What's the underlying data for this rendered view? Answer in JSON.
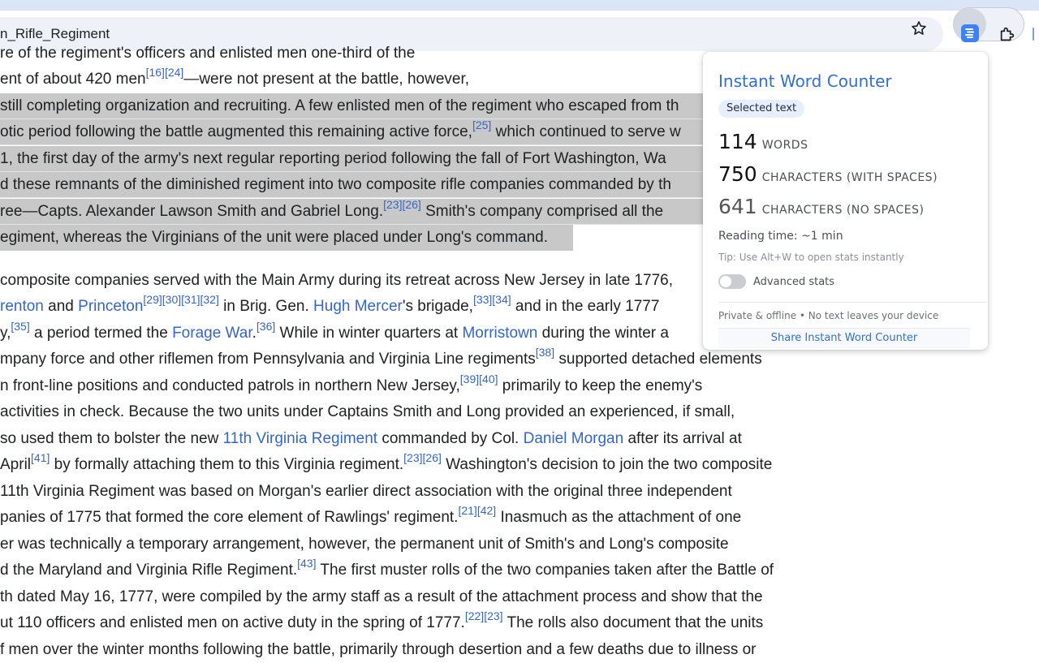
{
  "browser": {
    "address_text": "n_Rifle_Regiment",
    "bookmark_icon": "star-icon",
    "extension_icon": "word-counter-icon",
    "extensions_menu_icon": "puzzle-icon"
  },
  "article": {
    "lines": [
      {
        "text": "re of the regiment's officers and enlisted men          one-third of the"
      },
      {
        "parts": [
          "ent of about 420 men",
          "[16]",
          "[24]",
          "—were not present at the battle, however,"
        ]
      },
      {
        "text": "still completing organization and recruiting. A few enlisted men of the regiment who escaped from th"
      },
      {
        "parts": [
          "otic period following the battle augmented this remaining active force,",
          "[25]",
          " which continued to serve w"
        ]
      },
      {
        "text": " 1, the first day of the army's next regular reporting period following the fall of Fort Washington, Wa"
      },
      {
        "text": "d these remnants of the diminished regiment into two composite rifle companies commanded by th"
      },
      {
        "parts": [
          "ree—Capts. Alexander Lawson Smith and Gabriel Long.",
          "[23]",
          "[26]",
          " Smith's company comprised all the"
        ]
      },
      {
        "text": "egiment, whereas the Virginians of the unit were placed under Long's command."
      },
      {
        "text": "composite companies served with the Main Army during its retreat across New Jersey in late 1776,"
      },
      {
        "parts": [
          "renton",
          " and ",
          "Princeton",
          "[29]",
          "[30]",
          "[31]",
          "[32]",
          " in Brig. Gen. ",
          "Hugh Mercer",
          "'s brigade,",
          "[33]",
          "[34]",
          " and in the early 1777"
        ]
      },
      {
        "parts": [
          "y,",
          "[35]",
          " a period termed the ",
          "Forage War",
          ".",
          "[36]",
          " While in winter quarters at ",
          "Morristown",
          " during the winter a"
        ]
      },
      {
        "parts": [
          "mpany force and other riflemen from Pennsylvania and Virginia Line regiments",
          "[38]",
          " supported detached elements"
        ]
      },
      {
        "parts": [
          "n front-line positions and conducted patrols in northern New Jersey,",
          "[39]",
          "[40]",
          " primarily to keep the enemy's"
        ]
      },
      {
        "text": "activities in check. Because the two units under Captains Smith and Long provided an experienced, if small,"
      },
      {
        "parts": [
          "so used them to bolster the new ",
          "11th Virginia Regiment",
          " commanded by Col. ",
          "Daniel Morgan",
          " after its arrival at"
        ]
      },
      {
        "parts": [
          "April",
          "[41]",
          " by formally attaching them to this Virginia regiment.",
          "[23]",
          "[26]",
          " Washington's decision to join the two composite"
        ]
      },
      {
        "text": "11th Virginia Regiment was based on Morgan's earlier direct association with the original three independent"
      },
      {
        "parts": [
          "panies of 1775 that formed the core element of Rawlings' regiment.",
          "[21]",
          "[42]",
          " Inasmuch as the attachment of one"
        ]
      },
      {
        "text": "er was technically a temporary arrangement, however, the permanent unit of Smith's and Long's composite"
      },
      {
        "parts": [
          "d the Maryland and Virginia Rifle Regiment.",
          "[43]",
          " The first muster rolls of the two companies taken after the Battle of"
        ]
      },
      {
        "text": "th dated May 16, 1777, were compiled by the army staff as a result of the attachment process and show that the"
      },
      {
        "parts": [
          "ut 110 officers and enlisted men on active duty in the spring of 1777.",
          "[22]",
          "[23]",
          " The rolls also document that the units"
        ]
      },
      {
        "text": "f men over the winter months following the battle, primarily through desertion and a few deaths due to illness or"
      }
    ]
  },
  "popup": {
    "title": "Instant Word Counter",
    "badge": "Selected text",
    "words_value": "114",
    "words_label": "WORDS",
    "chars_spaces_value": "750",
    "chars_spaces_label": "CHARACTERS (WITH SPACES)",
    "chars_nospaces_value": "641",
    "chars_nospaces_label": "CHARACTERS (NO SPACES)",
    "reading_time": "Reading time: ~1 min",
    "tip": "Tip: Use Alt+W to open stats instantly",
    "advanced_label": "Advanced stats",
    "advanced_enabled": false,
    "privacy_text": "Private & offline • No text leaves your device",
    "share_label": "Share Instant Word Counter"
  },
  "colors": {
    "link": "#3366cc",
    "selection": "#c8c8c8",
    "popup_title": "#2f6fd6",
    "extension_icon_bg": "#3b82f6"
  }
}
